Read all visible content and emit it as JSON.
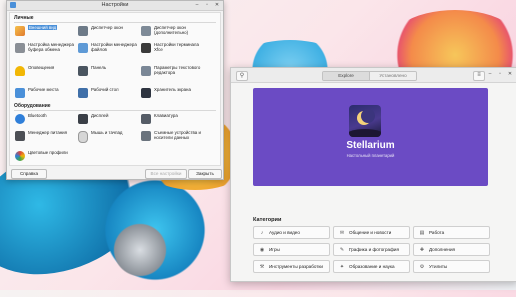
{
  "settings_window": {
    "title": "Настройки",
    "sections": {
      "personal": "Личные",
      "hardware": "Оборудование"
    },
    "items": [
      {
        "label": "Внешний вид",
        "icon": "appearance-icon",
        "color": "#e9a33b"
      },
      {
        "label": "Диспетчер окон",
        "icon": "window-manager-icon",
        "color": "#6d7a88"
      },
      {
        "label": "Диспетчер окон (дополнительно)",
        "icon": "window-manager-tweaks-icon",
        "color": "#7e8a97"
      },
      {
        "label": "Настройка менеджера буфера обмена",
        "icon": "clipboard-icon",
        "color": "#8a8f96"
      },
      {
        "label": "Настройки менеджера файлов",
        "icon": "file-manager-icon",
        "color": "#5e9ad6"
      },
      {
        "label": "Настройки терминала Xfce",
        "icon": "terminal-icon",
        "color": "#3a3a3a"
      },
      {
        "label": "Оповещения",
        "icon": "notification-bell-icon",
        "color": "#f2b705"
      },
      {
        "label": "Панель",
        "icon": "panel-icon",
        "color": "#4a5560"
      },
      {
        "label": "Параметры текстового редактора",
        "icon": "text-editor-icon",
        "color": "#7a8796"
      },
      {
        "label": "Рабочие места",
        "icon": "workspaces-icon",
        "color": "#4a90d9"
      },
      {
        "label": "Рабочий стол",
        "icon": "desktop-icon",
        "color": "#3f6fa8"
      },
      {
        "label": "Хранитель экрана",
        "icon": "screensaver-icon",
        "color": "#2e3440"
      }
    ],
    "hardware_items": [
      {
        "label": "Bluetooth",
        "icon": "bluetooth-icon",
        "color": "#2f7fd9"
      },
      {
        "label": "Дисплей",
        "icon": "display-icon",
        "color": "#3a3f47"
      },
      {
        "label": "Клавиатура",
        "icon": "keyboard-icon",
        "color": "#555c66"
      },
      {
        "label": "Менеджер питания",
        "icon": "power-manager-icon",
        "color": "#4c4f55"
      },
      {
        "label": "Мышь и тачпад",
        "icon": "mouse-icon",
        "color": "#d6d6d6"
      },
      {
        "label": "Съемные устройства и носители данных",
        "icon": "removable-drives-icon",
        "color": "#6a737d"
      },
      {
        "label": "Цветовые профили",
        "icon": "color-profiles-icon",
        "color": "#d9453c"
      }
    ],
    "buttons": {
      "help": "Справка",
      "all_settings": "Все настройки",
      "close": "Закрыть"
    }
  },
  "software_window": {
    "tabs": [
      "Explore",
      "Установлено"
    ],
    "featured": {
      "name": "Stellarium",
      "subtitle": "Настольный планетарий",
      "banner_color": "#6b4bc4"
    },
    "categories_title": "Категории",
    "categories": [
      {
        "label": "Аудио и видео",
        "icon": "audio-video-icon"
      },
      {
        "label": "Общение и новости",
        "icon": "chat-icon"
      },
      {
        "label": "Работа",
        "icon": "work-icon"
      },
      {
        "label": "Игры",
        "icon": "gamepad-icon"
      },
      {
        "label": "Графика и фотография",
        "icon": "graphics-icon"
      },
      {
        "label": "Дополнения",
        "icon": "addons-icon"
      },
      {
        "label": "Инструменты разработки",
        "icon": "dev-tools-icon"
      },
      {
        "label": "Образование и наука",
        "icon": "education-icon"
      },
      {
        "label": "Утилиты",
        "icon": "utilities-icon"
      }
    ]
  }
}
